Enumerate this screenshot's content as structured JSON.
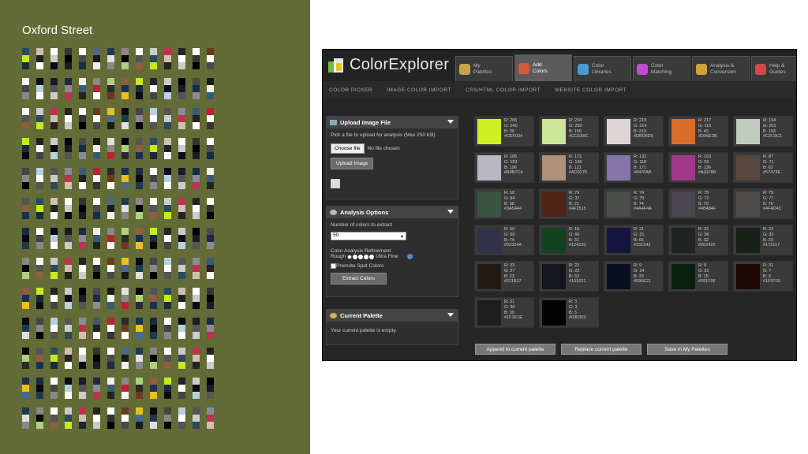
{
  "left_panel": {
    "title": "Oxford Street",
    "background": "#636b36"
  },
  "app": {
    "logo_text": "ColorExplorer",
    "tabs": [
      {
        "label_line1": "My",
        "label_line2": "Palettes",
        "icon": "palette-icon",
        "color": "#c9a34a"
      },
      {
        "label_line1": "Add",
        "label_line2": "Colors",
        "icon": "paintbrush-icon",
        "color": "#d05a3a",
        "active": true
      },
      {
        "label_line1": "Color",
        "label_line2": "Libraries",
        "icon": "books-icon",
        "color": "#4a9ad0"
      },
      {
        "label_line1": "Color",
        "label_line2": "Matching",
        "icon": "color-wheel-icon",
        "color": "#c04ad0"
      },
      {
        "label_line1": "Analysis &",
        "label_line2": "Conversion",
        "icon": "chart-icon",
        "color": "#d0a03a"
      },
      {
        "label_line1": "Help &",
        "label_line2": "Guides",
        "icon": "lifebuoy-icon",
        "color": "#d04a4a"
      }
    ],
    "subnav": [
      "COLOR PICKER",
      "IMAGE COLOR IMPORT",
      "CSS/HTML COLOR IMPORT",
      "WEBSITE COLOR IMPORT"
    ],
    "upload": {
      "header": "Upload Image File",
      "instruction": "Pick a file to upload for analysis (Max 250 KB)",
      "choose_file": "Choose file",
      "no_file": "No file chosen",
      "upload_button": "Upload Image"
    },
    "analysis": {
      "header": "Analysis Options",
      "num_colors_label": "Number of colors to extract",
      "num_colors_value": "50",
      "refinement_label": "Color Analysis Refinement",
      "rough": "Rough",
      "ultra_fine": "Ultra Fine",
      "promote_label": "Promote Spot Colors",
      "extract_button": "Extract Colors"
    },
    "current_palette": {
      "header": "Current Palette",
      "empty_text": "Your current palette is empty."
    },
    "swatches": [
      {
        "r": "R: 206",
        "g": "G: 240",
        "b": "B: 36",
        "hex": "#CEF024"
      },
      {
        "r": "R: 204",
        "g": "G: 230",
        "b": "B: 156",
        "hex": "#CCE69C"
      },
      {
        "r": "R: 219",
        "g": "G: 214",
        "b": "B: 213",
        "hex": "#DBD6D5"
      },
      {
        "r": "R: 217",
        "g": "G: 110",
        "b": "B: 43",
        "hex": "#D96E2B"
      },
      {
        "r": "R: 194",
        "g": "G: 201",
        "b": "B: 193",
        "hex": "#C2C9C1"
      },
      {
        "r": "R: 185",
        "g": "G: 183",
        "b": "B: 196",
        "hex": "#B9B7C4"
      },
      {
        "r": "R: 173",
        "g": "G: 146",
        "b": "B: 121",
        "hex": "#AD9279"
      },
      {
        "r": "R: 132",
        "g": "G: 118",
        "b": "B: 171",
        "hex": "#8476AB"
      },
      {
        "r": "R: 163",
        "g": "G: 55",
        "b": "B: 136",
        "hex": "#A33788"
      },
      {
        "r": "R: 87",
        "g": "G: 71",
        "b": "B: 62",
        "hex": "#57473E"
      },
      {
        "r": "R: 58",
        "g": "G: 84",
        "b": "B: 68",
        "hex": "#3A5444"
      },
      {
        "r": "R: 79",
        "g": "G: 37",
        "b": "B: 21",
        "hex": "#4F2515"
      },
      {
        "r": "R: 74",
        "g": "G: 79",
        "b": "B: 74",
        "hex": "#4A4F4A"
      },
      {
        "r": "R: 75",
        "g": "G: 72",
        "b": "B: 79",
        "hex": "#4B484F"
      },
      {
        "r": "R: 79",
        "g": "G: 77",
        "b": "B: 76",
        "hex": "#4F4D4C"
      },
      {
        "r": "R: 50",
        "g": "G: 50",
        "b": "B: 74",
        "hex": "#32324A"
      },
      {
        "r": "R: 18",
        "g": "G: 66",
        "b": "B: 32",
        "hex": "#124220"
      },
      {
        "r": "R: 21",
        "g": "G: 21",
        "b": "B: 66",
        "hex": "#151542"
      },
      {
        "r": "R: 32",
        "g": "G: 36",
        "b": "B: 32",
        "hex": "#202420"
      },
      {
        "r": "R: 23",
        "g": "G: 33",
        "b": "B: 23",
        "hex": "#172117"
      },
      {
        "r": "R: 33",
        "g": "G: 27",
        "b": "B: 23",
        "hex": "#211B17"
      },
      {
        "r": "R: 22",
        "g": "G: 22",
        "b": "B: 33",
        "hex": "#161621"
      },
      {
        "r": "R: 9",
        "g": "G: 14",
        "b": "B: 33",
        "hex": "#090E21"
      },
      {
        "r": "R: 9",
        "g": "G: 31",
        "b": "B: 15",
        "hex": "#091F0F"
      },
      {
        "r": "R: 31",
        "g": "G: 7",
        "b": "B: 3",
        "hex": "#1F0703"
      },
      {
        "r": "R: 31",
        "g": "G: 30",
        "b": "B: 30",
        "hex": "#1F1E1E"
      },
      {
        "r": "R: 3",
        "g": "G: 3",
        "b": "B: 3",
        "hex": "#030303"
      }
    ],
    "bottom_buttons": [
      "Append to current palette",
      "Replace current palette",
      "Save in My Palettes"
    ]
  }
}
